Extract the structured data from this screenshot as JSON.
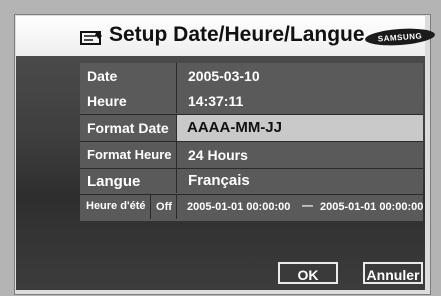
{
  "header": {
    "title": "Setup Date/Heure/Langue",
    "brand": "SAMSUNG",
    "icon": "settings-card-icon"
  },
  "settings": {
    "date": {
      "label": "Date",
      "value": "2005-03-10"
    },
    "time": {
      "label": "Heure",
      "value": "14:37:11"
    },
    "date_format": {
      "label": "Format Date",
      "value": "AAAA-MM-JJ"
    },
    "time_format": {
      "label": "Format Heure",
      "value": "24 Hours"
    },
    "language": {
      "label": "Langue",
      "value": "Français"
    },
    "dst": {
      "label": "Heure d'été",
      "state": "Off",
      "start": "2005-01-01 00:00:00",
      "separator": "—",
      "end": "2005-01-01 00:00:00"
    }
  },
  "buttons": {
    "ok": "OK",
    "cancel": "Annuler"
  },
  "colors": {
    "selected_row": "#c9c9c9",
    "panel": "#3e3e3e",
    "cell": "#5a5a5a"
  }
}
